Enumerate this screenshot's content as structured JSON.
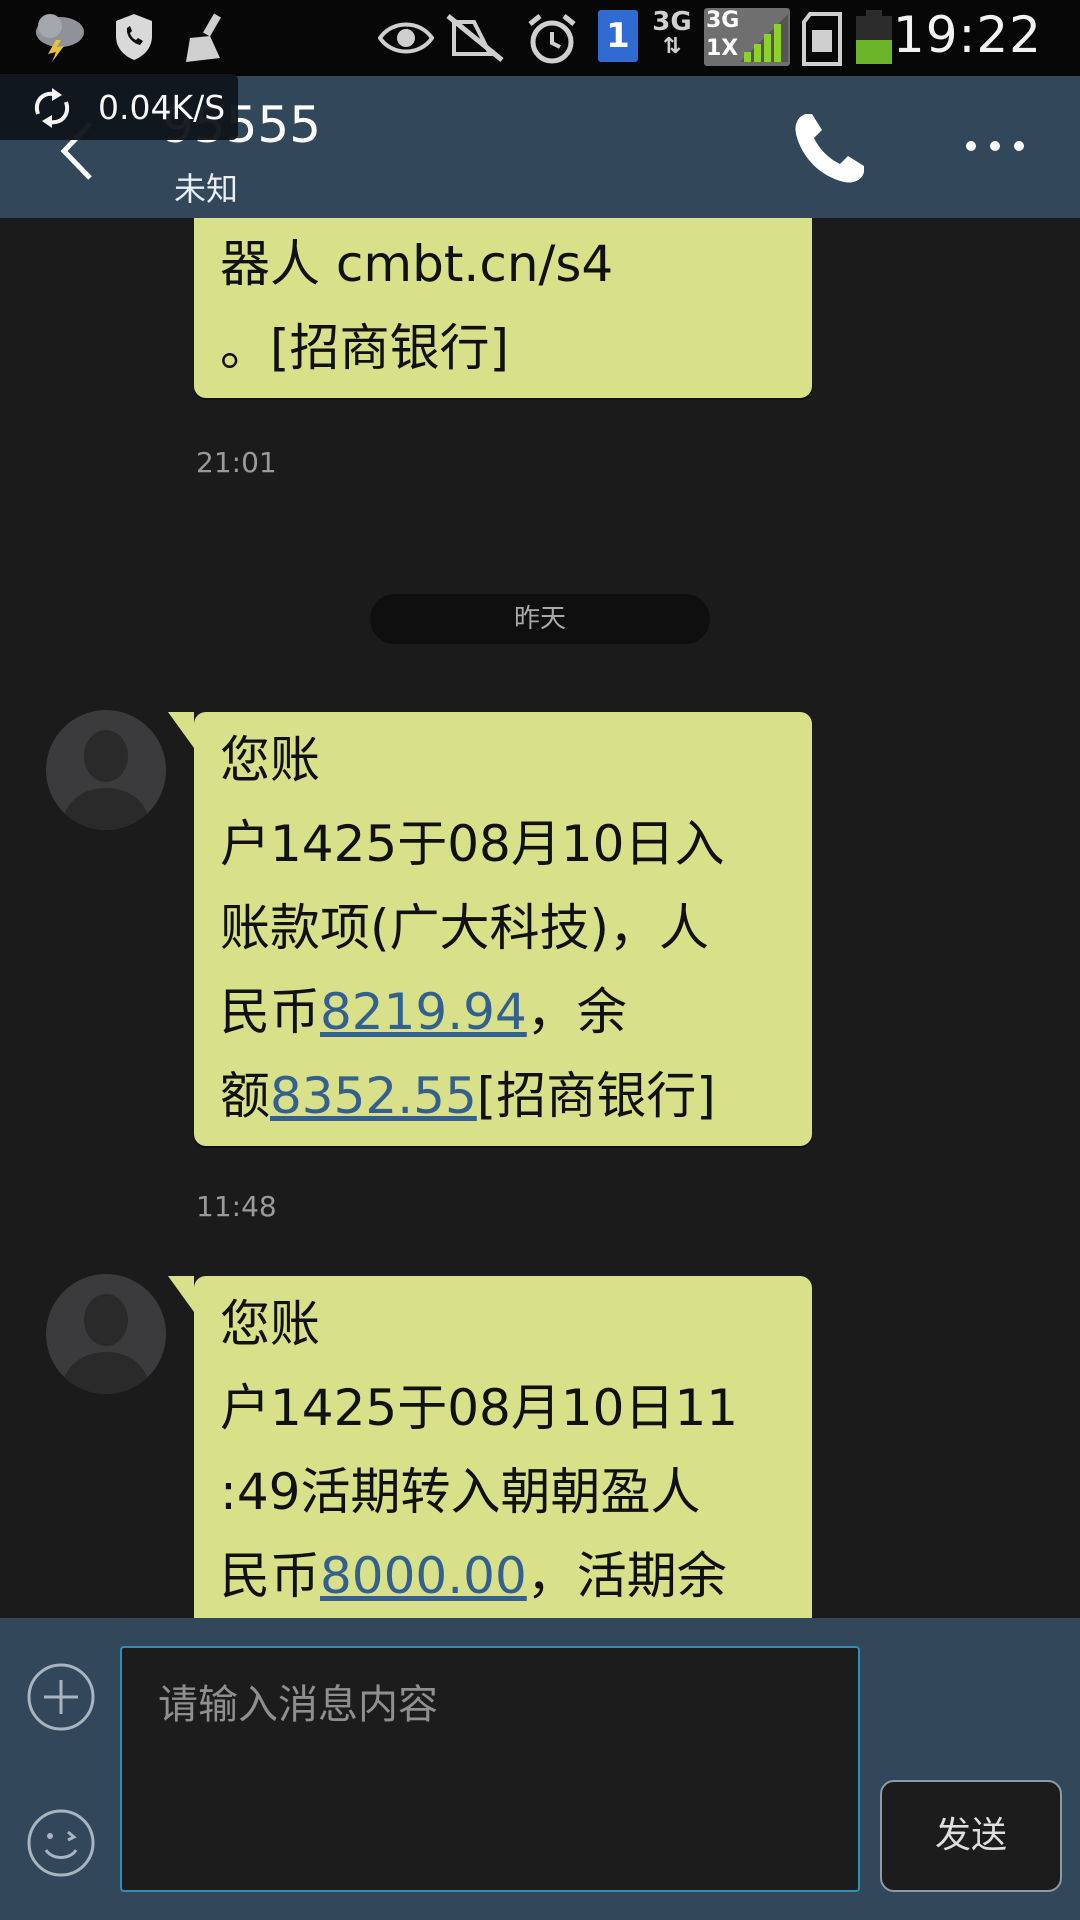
{
  "status_bar": {
    "time": "19:22",
    "sim_slot": "1",
    "network_3g": "3G",
    "network_3g_1x_top": "3G",
    "network_3g_1x_bottom": "1X",
    "icons": [
      "weather-storm-icon",
      "shield-phone-icon",
      "cleaner-icon",
      "eye-icon",
      "mute-icon",
      "alarm-icon",
      "sim-card-icon",
      "data-arrows-icon",
      "signal-icon",
      "sd-card-icon",
      "battery-icon"
    ]
  },
  "netspeed": {
    "value": "0.04K/S"
  },
  "header": {
    "contact_number": "95555",
    "contact_sub": "未知"
  },
  "date_pill": "昨天",
  "messages": [
    {
      "lines": [
        "器人 cmbt.cn/s4",
        "。[招商银行]"
      ],
      "time": "21:01"
    },
    {
      "lines": [
        "您账",
        "户1425于08月10日入",
        "账款项(广大科技)，人"
      ],
      "line4_prefix": "民币",
      "line4_amount": "8219.94",
      "line4_suffix": "，余",
      "line5_prefix": "额",
      "line5_amount": "8352.55",
      "line5_suffix": "[招商银行]",
      "time": "11:48"
    },
    {
      "lines": [
        "您账",
        "户1425于08月10日11",
        ":49活期转入朝朝盈人"
      ],
      "line4_prefix": "民币",
      "line4_amount": "8000.00",
      "line4_suffix": "，活期余"
    }
  ],
  "composer": {
    "placeholder": "请输入消息内容",
    "send_label": "发送"
  },
  "colors": {
    "bubble": "#d8e18a",
    "header": "#33475b",
    "background": "#1b1b1c",
    "link": "#34608f",
    "input_border": "#2f8fb7"
  }
}
